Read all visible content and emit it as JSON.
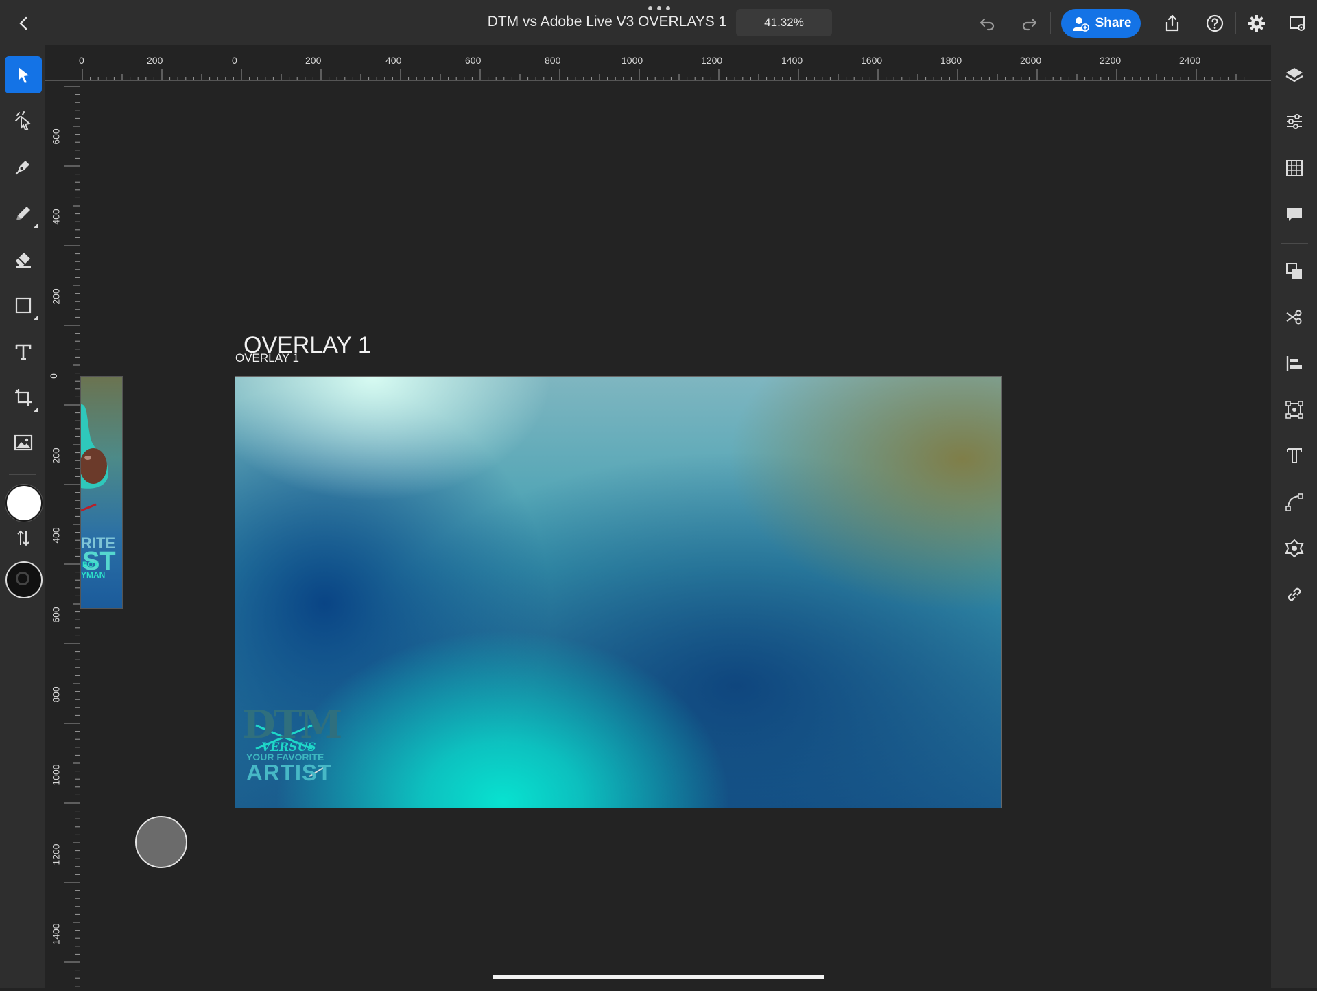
{
  "topbar": {
    "title": "DTM vs Adobe Live V3 OVERLAYS 1",
    "zoom": "41.32%",
    "share_label": "Share",
    "icons": [
      "back-icon",
      "more-icon",
      "undo-icon",
      "redo-icon",
      "share-user-icon",
      "export-icon",
      "help-icon",
      "settings-icon",
      "preview-icon"
    ]
  },
  "left_toolbar": {
    "tools": [
      "select",
      "touch-modifier",
      "pen",
      "pencil",
      "eraser",
      "shape",
      "type",
      "crop",
      "place-image",
      "fill-color",
      "swap-colors",
      "stroke-color"
    ],
    "fill_color": "#ffffff",
    "stroke_color": "#1a1a1a"
  },
  "right_toolbar": {
    "panels": [
      "layers",
      "properties",
      "grid",
      "comments",
      "arrange",
      "cut",
      "align",
      "transform",
      "type-properties",
      "path",
      "pattern",
      "links"
    ]
  },
  "ruler": {
    "horizontal_labels": [
      "0",
      "200",
      "0",
      "200",
      "400",
      "600",
      "800",
      "1000",
      "1200",
      "1400",
      "1600",
      "1800",
      "2000",
      "2200",
      "2400"
    ],
    "vertical_labels": [
      "600",
      "400",
      "200",
      "0",
      "200",
      "400",
      "600",
      "800",
      "1000",
      "1200",
      "1400"
    ]
  },
  "canvas": {
    "artboard_name": "OVERLAY 1",
    "artboard_name_small": "OVERLAY 1",
    "logo": {
      "big": "DTM",
      "versus": "VERSUS",
      "favorite": "YOUR FAVORITE",
      "artist": "ARTIST"
    },
    "side_artboard": {
      "line1": "RITE",
      "line2": "ST",
      "line3": "BOX",
      "line4": "YMAN"
    }
  },
  "colors": {
    "accent": "#1473e6",
    "panel_bg": "#2e2e2e",
    "canvas_bg": "#232323"
  }
}
